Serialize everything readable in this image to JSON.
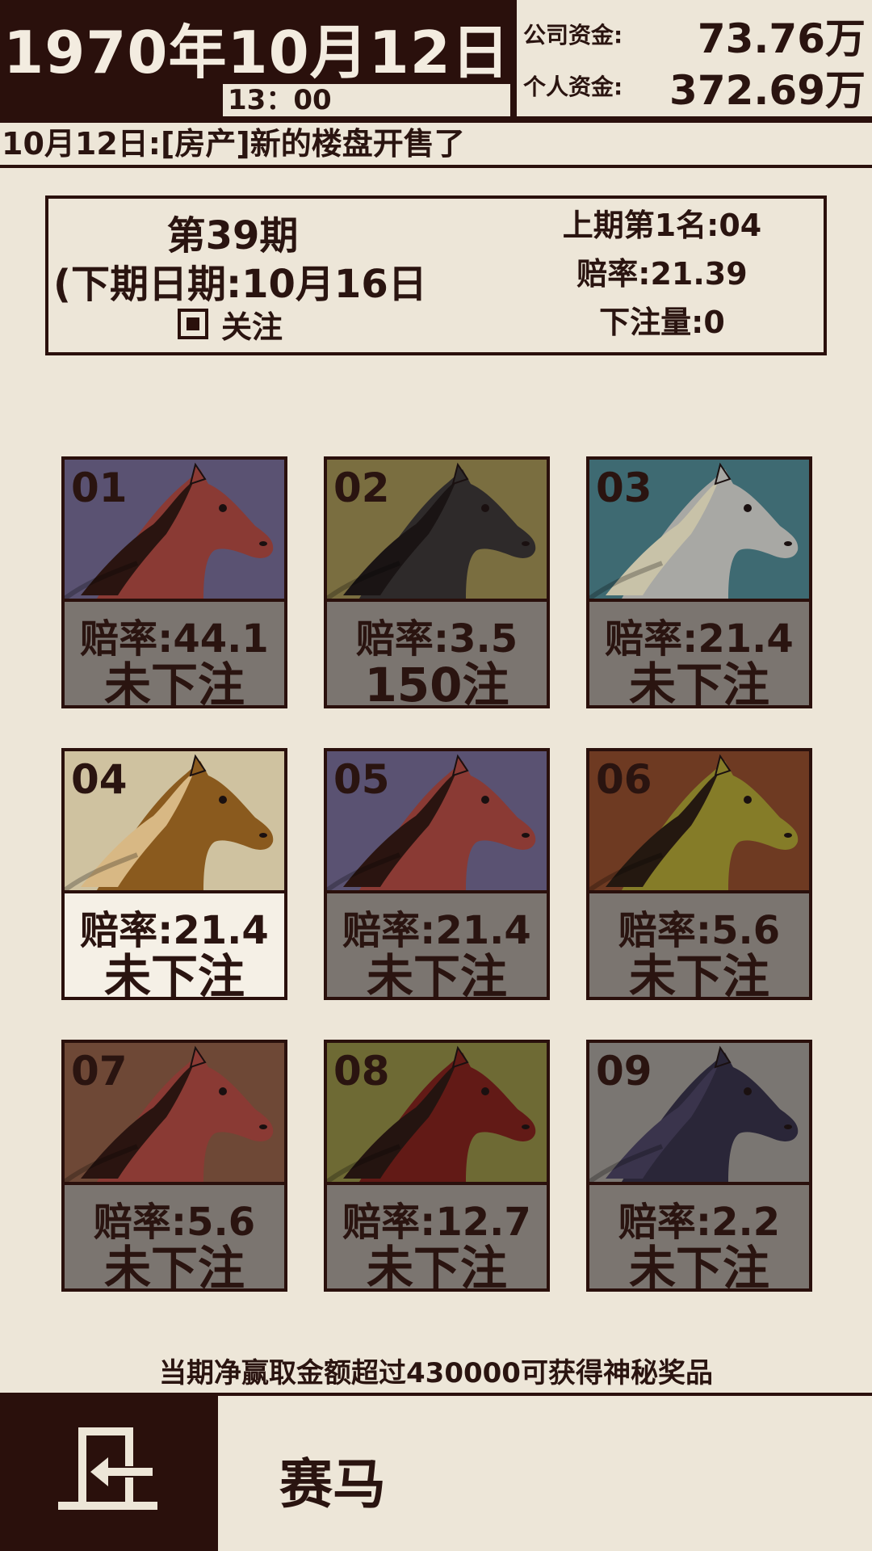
{
  "header": {
    "date": "1970年10月12日",
    "time": "13：00",
    "company_funds_label": "公司资金:",
    "company_funds_value": "73.76万",
    "personal_funds_label": "个人资金:",
    "personal_funds_value": "372.69万"
  },
  "news": "10月12日:[房产]新的楼盘开售了",
  "race_info": {
    "period": "第39期",
    "next_date": "(下期日期:10月16日",
    "follow_label": "关注",
    "follow_checked": true,
    "last_winner": "上期第1名:04",
    "odds": "赔率:21.39",
    "bet_amount": "下注量:0"
  },
  "horses": [
    {
      "num": "01",
      "odds": "赔率:44.1",
      "bet": "未下注",
      "bg": "#5a5272",
      "coat": "#8a3a34",
      "mane": "#2a1410",
      "selected": false
    },
    {
      "num": "02",
      "odds": "赔率:3.5",
      "bet": "150注",
      "bg": "#7a6e40",
      "coat": "#2e2a2a",
      "mane": "#1a1414",
      "selected": false
    },
    {
      "num": "03",
      "odds": "赔率:21.4",
      "bet": "未下注",
      "bg": "#3e6a72",
      "coat": "#a8a8a4",
      "mane": "#c8c2a8",
      "selected": false
    },
    {
      "num": "04",
      "odds": "赔率:21.4",
      "bet": "未下注",
      "bg": "#cfc2a0",
      "coat": "#8a5a1e",
      "mane": "#d8b884",
      "selected": true
    },
    {
      "num": "05",
      "odds": "赔率:21.4",
      "bet": "未下注",
      "bg": "#5a5272",
      "coat": "#8a3a34",
      "mane": "#2a1410",
      "selected": false
    },
    {
      "num": "06",
      "odds": "赔率:5.6",
      "bet": "未下注",
      "bg": "#6e3a22",
      "coat": "#857c28",
      "mane": "#241810",
      "selected": false
    },
    {
      "num": "07",
      "odds": "赔率:5.6",
      "bet": "未下注",
      "bg": "#6e4836",
      "coat": "#8a3a34",
      "mane": "#2a1410",
      "selected": false
    },
    {
      "num": "08",
      "odds": "赔率:12.7",
      "bet": "未下注",
      "bg": "#6e6a34",
      "coat": "#621a16",
      "mane": "#241410",
      "selected": false
    },
    {
      "num": "09",
      "odds": "赔率:2.2",
      "bet": "未下注",
      "bg": "#7a7672",
      "coat": "#2a2638",
      "mane": "#3a344c",
      "selected": false
    }
  ],
  "bonus_text": "当期净赢取金额超过430000可获得神秘奖品",
  "footer": {
    "title": "赛马",
    "exit_icon": "exit-icon"
  }
}
